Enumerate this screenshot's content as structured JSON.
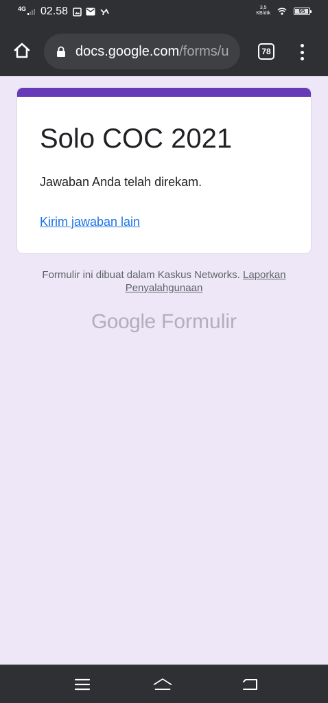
{
  "status_bar": {
    "network": "4G",
    "time": "02.58",
    "speed_value": "3,5",
    "speed_unit": "KB/dtk",
    "battery": "95",
    "battery_level": 0.95,
    "icons": [
      "gallery-icon",
      "mail-icon",
      "messenger-icon",
      "wifi-icon"
    ]
  },
  "browser": {
    "url_host": "docs.google.com",
    "url_path": "/forms/u",
    "tab_count": "78",
    "icons": [
      "home-icon",
      "lock-icon",
      "tabs-icon",
      "overflow-menu-icon"
    ]
  },
  "form": {
    "title": "Solo COC 2021",
    "confirmation": "Jawaban Anda telah direkam.",
    "another_response_link": "Kirim jawaban lain",
    "accent_color": "#673ab7",
    "link_color": "#1a73e8"
  },
  "footer": {
    "text": "Formulir ini dibuat dalam Kaskus Networks.",
    "report_link": "Laporkan Penyalahgunaan",
    "brand_google": "Google",
    "brand_product": "Formulir"
  },
  "nav_bar": {
    "icons": [
      "recents-icon",
      "home-nav-icon",
      "back-icon"
    ]
  },
  "colors": {
    "background": "#ede7f7",
    "chrome": "#2f3033"
  }
}
